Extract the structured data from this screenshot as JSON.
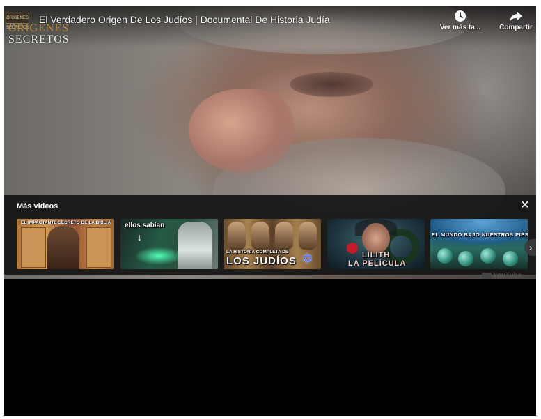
{
  "player": {
    "title": "El Verdadero Origen De Los Judíos | Documental De Historia Judía",
    "channel_logo": {
      "mini_text": "ORIGENES SECRETOS",
      "line1": "ORIGENES",
      "line2": "SECRETOS"
    },
    "actions": [
      {
        "label": "Ver más ta...",
        "icon": "clock-icon"
      },
      {
        "label": "Compartir",
        "icon": "share-icon"
      }
    ],
    "watermark": "YouTube"
  },
  "more_videos": {
    "title": "Más videos",
    "close_icon": "close-icon",
    "next_icon": "chevron-right-icon",
    "videos": [
      {
        "caption": "EL IMPACTANTE SECRETO DE LA BIBLIA"
      },
      {
        "caption": "ellos sabían"
      },
      {
        "caption_small": "LA HISTORIA COMPLETA DE",
        "caption_large": "LOS JUDÍOS"
      },
      {
        "caption_line1": "LILITH",
        "caption_line2": "LA PELÍCULA"
      },
      {
        "caption": "EL MUNDO BAJO NUESTROS PIES"
      }
    ]
  }
}
